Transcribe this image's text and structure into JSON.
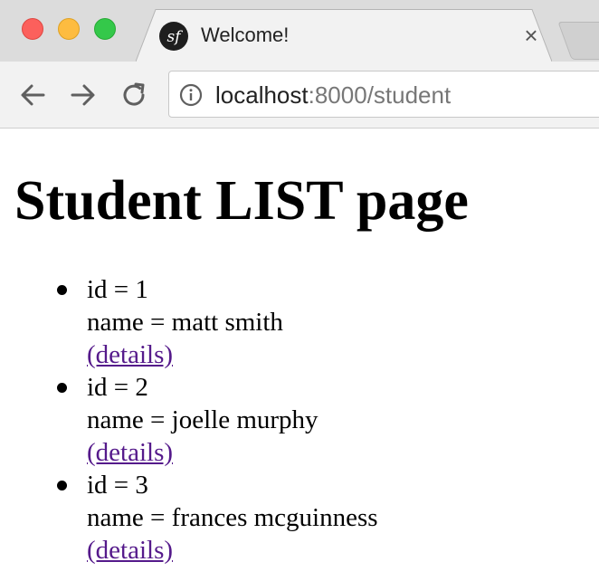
{
  "browser": {
    "tab_title": "Welcome!",
    "tab_close_glyph": "×",
    "url_host": "localhost",
    "url_rest": ":8000/student"
  },
  "page": {
    "title": "Student LIST page",
    "students": [
      {
        "id_line": "id = 1",
        "name_line": "name = matt smith",
        "link": "(details)"
      },
      {
        "id_line": "id = 2",
        "name_line": "name = joelle murphy",
        "link": "(details)"
      },
      {
        "id_line": "id = 3",
        "name_line": "name = frances mcguinness",
        "link": "(details)"
      }
    ]
  },
  "icons": {
    "favicon": "symfony-logo-icon",
    "back": "back-arrow-icon",
    "forward": "forward-arrow-icon",
    "reload": "reload-icon",
    "info": "info-icon"
  },
  "colors": {
    "visited_link": "#551a8b",
    "tab_active": "#f2f2f2",
    "tabstrip": "#dcdcdc"
  }
}
